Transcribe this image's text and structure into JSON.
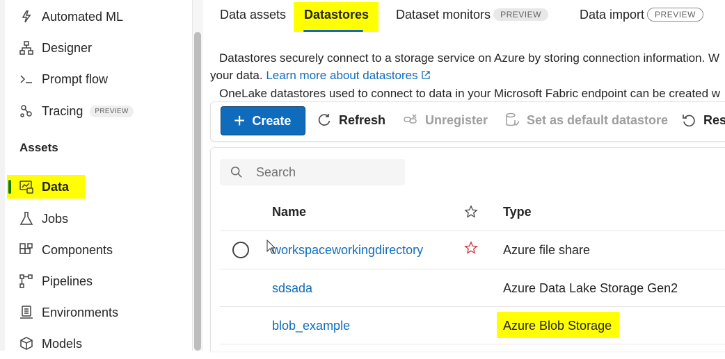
{
  "sidebar": {
    "items": [
      {
        "label": "Automated ML",
        "icon": "automated-ml-icon"
      },
      {
        "label": "Designer",
        "icon": "designer-icon"
      },
      {
        "label": "Prompt flow",
        "icon": "prompt-flow-icon"
      },
      {
        "label": "Tracing",
        "icon": "tracing-icon",
        "badge": "PREVIEW"
      }
    ],
    "section_heading": "Assets",
    "asset_items": [
      {
        "label": "Data",
        "icon": "data-icon",
        "selected": true
      },
      {
        "label": "Jobs",
        "icon": "jobs-icon"
      },
      {
        "label": "Components",
        "icon": "components-icon"
      },
      {
        "label": "Pipelines",
        "icon": "pipelines-icon"
      },
      {
        "label": "Environments",
        "icon": "environments-icon"
      },
      {
        "label": "Models",
        "icon": "models-icon"
      }
    ]
  },
  "tabs": [
    {
      "label": "Data assets"
    },
    {
      "label": "Datastores",
      "active": true
    },
    {
      "label": "Dataset monitors",
      "badge": "PREVIEW"
    },
    {
      "label": "Data import",
      "badge": "PREVIEW"
    }
  ],
  "description": {
    "line1": "Datastores securely connect to a storage service on Azure by storing connection information. W",
    "line2_prefix": "your data. ",
    "line2_link": "Learn more about datastores",
    "line3": "OneLake datastores used to connect to data in your Microsoft Fabric endpoint can be created w"
  },
  "toolbar": {
    "create_label": "Create",
    "refresh_label": "Refresh",
    "unregister_label": "Unregister",
    "set_default_label": "Set as default datastore",
    "reset_label": "Rese"
  },
  "search": {
    "placeholder": "Search"
  },
  "table": {
    "columns": {
      "name": "Name",
      "type": "Type"
    },
    "rows": [
      {
        "name": "workspaceworkingdirectory",
        "type": "Azure file share",
        "favorite": true
      },
      {
        "name": "sdsada",
        "type": "Azure Data Lake Storage Gen2"
      },
      {
        "name": "blob_example",
        "type": "Azure Blob Storage"
      }
    ]
  },
  "colors": {
    "accent": "#0f6cbd",
    "selected_indicator": "#107c10",
    "highlight": "#ffff00",
    "favorite_star": "#d13438"
  }
}
